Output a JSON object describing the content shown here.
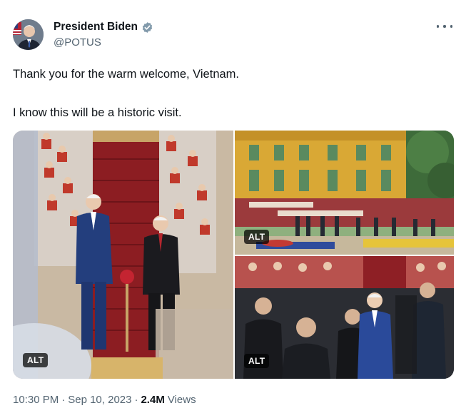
{
  "author": {
    "display_name": "President Biden",
    "handle": "@POTUS",
    "avatar_icon": "avatar-portrait",
    "verified_icon": "verified-badge-icon",
    "verified_color": "#829aab"
  },
  "tweet": {
    "line1": "Thank you for the warm welcome, Vietnam.",
    "line2": "I know this will be a historic visit."
  },
  "media": {
    "photos": [
      {
        "alt_label": "ALT"
      },
      {
        "alt_label": "ALT"
      },
      {
        "alt_label": "ALT"
      }
    ]
  },
  "meta": {
    "time": "10:30 PM",
    "sep1": "·",
    "date": "Sep 10, 2023",
    "sep2": "·",
    "views_count": "2.4M",
    "views_label": "Views"
  },
  "colors": {
    "text_primary": "#0f1419",
    "text_secondary": "#536471",
    "carpet_red": "#b8232b",
    "palace_yellow": "#d9a835"
  }
}
